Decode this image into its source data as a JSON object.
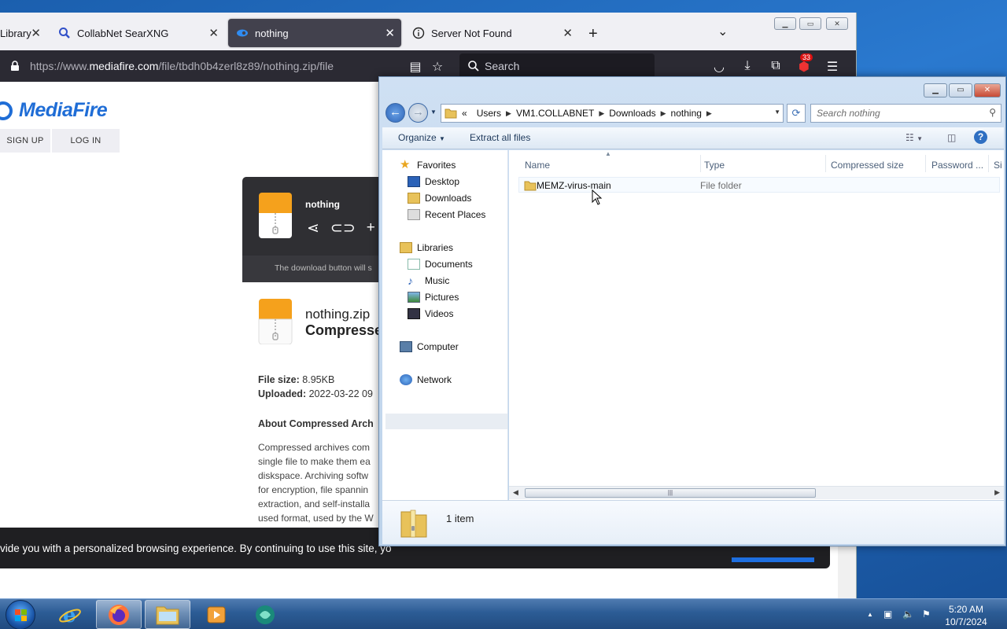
{
  "browser": {
    "tabs": [
      {
        "label": "Library",
        "active": false
      },
      {
        "label": "CollabNet SearXNG",
        "active": false
      },
      {
        "label": "nothing",
        "active": true
      },
      {
        "label": "Server Not Found",
        "active": false
      }
    ],
    "url": {
      "prefix": "https://www.",
      "domain": "mediafire.com",
      "path": "/file/tbdh0b4zerl8z89/nothing.zip/file"
    },
    "search_placeholder": "Search",
    "extension_badge": "33"
  },
  "mediafire": {
    "logo_text": "MediaFire",
    "signup_label": "SIGN UP",
    "login_label": "LOG IN",
    "card_filename": "nothing",
    "card_note": "The download button will s",
    "file_title": "nothing.zip",
    "file_subtitle": "Compresse",
    "file_size_label": "File size:",
    "file_size_value": "8.95KB",
    "uploaded_label": "Uploaded:",
    "uploaded_value": "2022-03-22 09",
    "about_title": "About Compressed Arch",
    "about_lines": [
      "Compressed archives com",
      "single file to make them ea",
      "diskspace. Archiving softw",
      "for encryption, file spannin",
      "extraction, and self-installa",
      "used format, used by the W"
    ],
    "cookie_text": "vide you with a personalized browsing experience. By continuing to use this site, yo"
  },
  "explorer": {
    "breadcrumb": [
      "Users",
      "VM1.COLLABNET",
      "Downloads",
      "nothing"
    ],
    "breadcrumb_prefix": "«",
    "search_placeholder": "Search nothing",
    "commands": {
      "organize": "Organize",
      "extract": "Extract all files"
    },
    "nav": {
      "favorites": "Favorites",
      "desktop": "Desktop",
      "downloads": "Downloads",
      "recent": "Recent Places",
      "libraries": "Libraries",
      "documents": "Documents",
      "music": "Music",
      "pictures": "Pictures",
      "videos": "Videos",
      "computer": "Computer",
      "network": "Network"
    },
    "columns": [
      "Name",
      "Type",
      "Compressed size",
      "Password ...",
      "Si"
    ],
    "rows": [
      {
        "name": "MEMZ-virus-main",
        "type": "File folder"
      }
    ],
    "status_count": "1 item"
  },
  "taskbar": {
    "time": "5:20 AM",
    "date": "10/7/2024"
  },
  "colors": {
    "browser_toolbar": "#2b2a33",
    "active_tab": "#42414d",
    "mediafire_blue": "#1f6dd6",
    "desktop_blue": "#2a79cf"
  }
}
